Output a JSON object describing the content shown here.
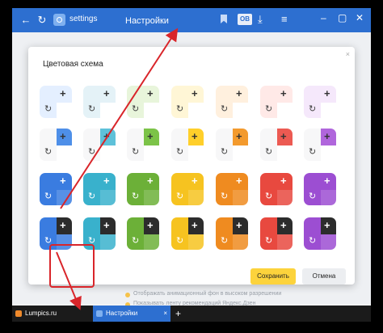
{
  "browser": {
    "url_text": "settings",
    "page_title": "Настройки",
    "ext_label": "OB"
  },
  "dialog": {
    "title": "Цветовая схема",
    "close": "×",
    "save_label": "Сохранить",
    "cancel_label": "Отмена",
    "selected_index": 18
  },
  "background": {
    "line1": "Отображать анимационный фон в высоком разрешении",
    "line2": "Показывать ленту рекомендаций Яндекс.Дзен"
  },
  "palette": [
    "#e4efff",
    "#e4f2f7",
    "#e8f5db",
    "#fff6d6",
    "#fff0de",
    "#ffe9e7",
    "#f5e8fb",
    "#4e8fe8",
    "#5ec1d9",
    "#7cc348",
    "#ffcf2a",
    "#f39a2d",
    "#ec5a52",
    "#b066dc",
    "#3a7ce0",
    "#39b1cc",
    "#6cb038",
    "#f6c320",
    "#ef8b20",
    "#e8493f",
    "#9c4ed2"
  ],
  "taskbar": {
    "tab1_label": "Lumpics.ru",
    "tab2_label": "Настройки",
    "tab_close": "×",
    "new_tab": "+"
  },
  "icons": {
    "plus": "+",
    "refresh": "↻"
  }
}
